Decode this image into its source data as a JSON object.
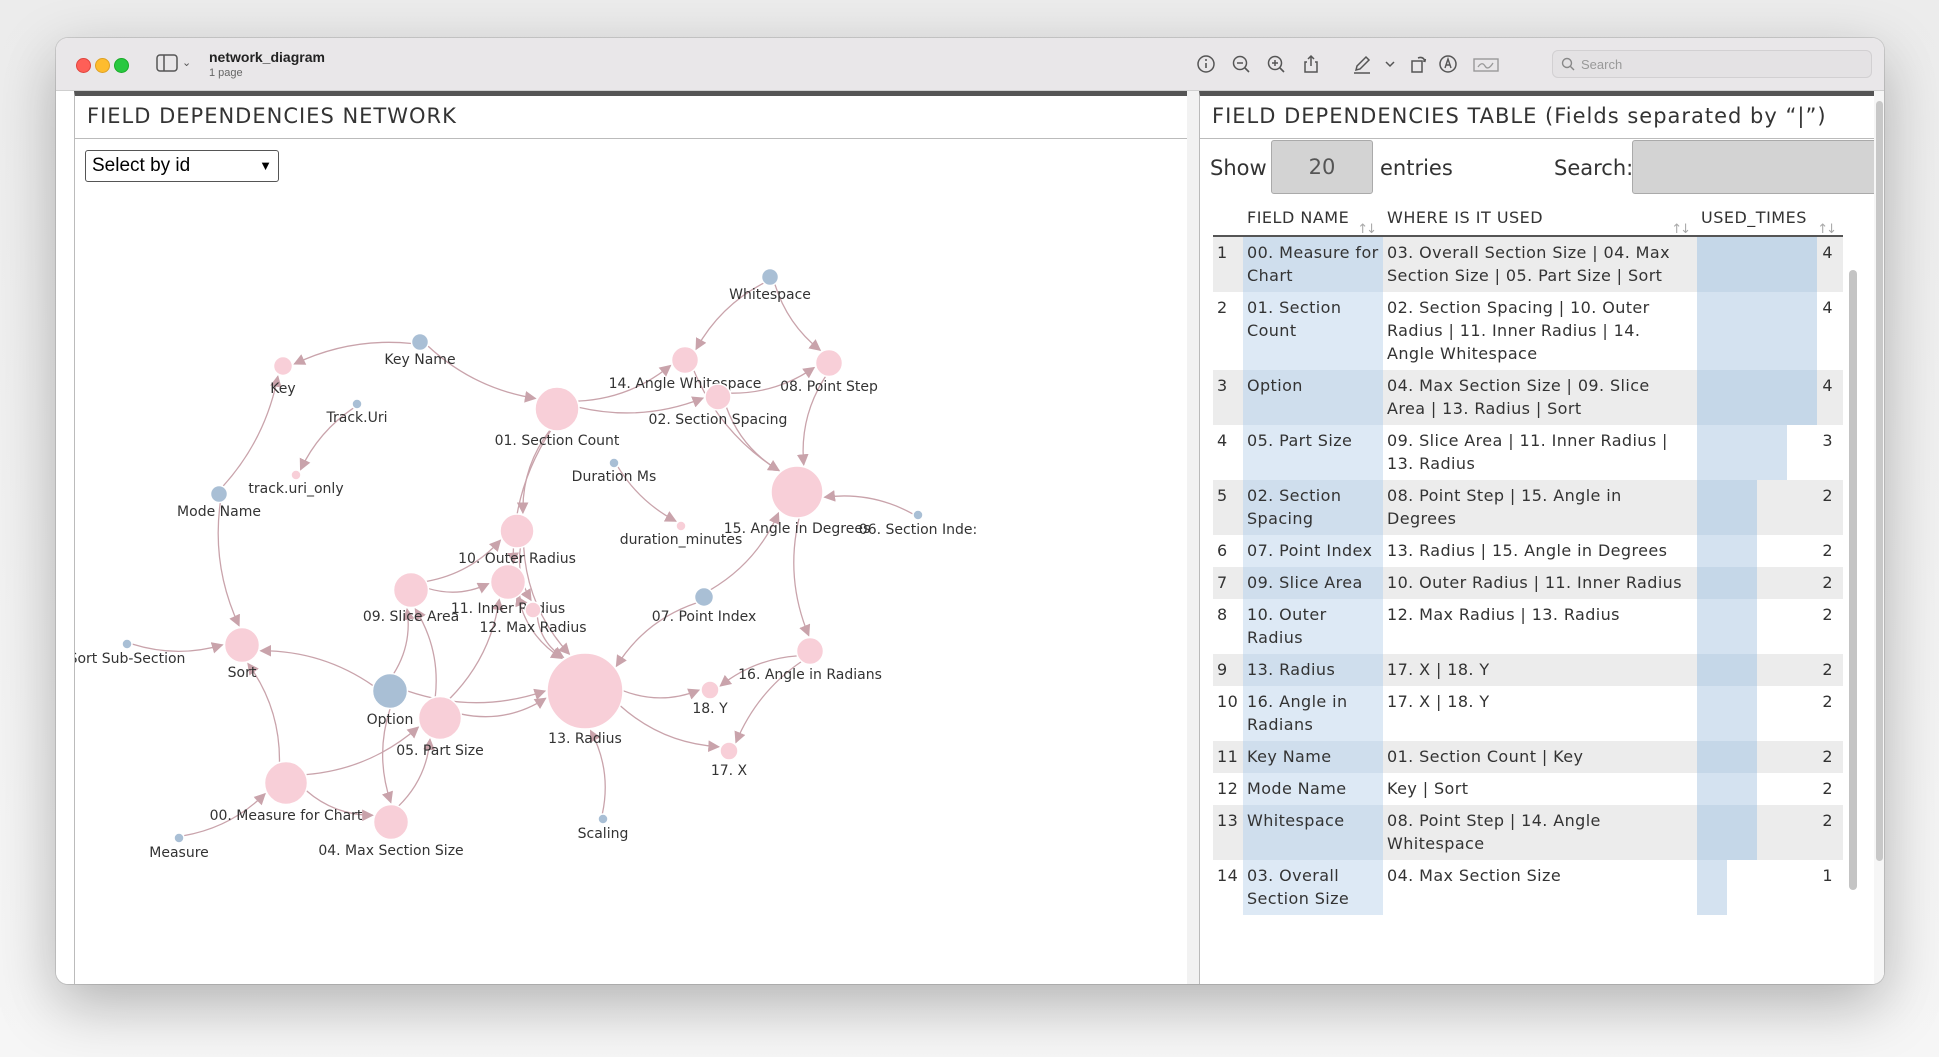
{
  "window": {
    "title": "network_diagram",
    "subtitle": "1 page",
    "search_placeholder": "Search",
    "toolbar_icons": [
      "info-icon",
      "zoom-out-icon",
      "zoom-in-icon",
      "share-icon",
      "markup-pen-icon",
      "chevron-down-icon",
      "rotate-icon",
      "annotate-icon",
      "signature-icon"
    ]
  },
  "network": {
    "title": "FIELD DEPENDENCIES NETWORK",
    "select_label": "Select by id",
    "colors": {
      "calculated": "#f8cfd8",
      "source": "#a9bfd5",
      "edge": "#c9a3ab",
      "label": "#333333"
    },
    "nodes": [
      {
        "id": "whitespace",
        "label": "Whitespace",
        "type": "source"
      },
      {
        "id": "key_name",
        "label": "Key Name",
        "type": "source"
      },
      {
        "id": "key",
        "label": "Key",
        "type": "calculated"
      },
      {
        "id": "track_uri",
        "label": "Track.Uri",
        "type": "source"
      },
      {
        "id": "track_uri_only",
        "label": "track.uri_only",
        "type": "calculated"
      },
      {
        "id": "mode_name",
        "label": "Mode Name",
        "type": "source"
      },
      {
        "id": "section_count",
        "label": "01. Section Count",
        "type": "calculated"
      },
      {
        "id": "angle_whitespace",
        "label": "14. Angle Whitespace",
        "type": "calculated"
      },
      {
        "id": "section_spacing",
        "label": "02. Section Spacing",
        "type": "calculated"
      },
      {
        "id": "point_step",
        "label": "08. Point Step",
        "type": "calculated"
      },
      {
        "id": "duration_ms",
        "label": "Duration Ms",
        "type": "source"
      },
      {
        "id": "duration_minutes",
        "label": "duration_minutes",
        "type": "calculated"
      },
      {
        "id": "angle_degrees",
        "label": "15. Angle in Degrees",
        "type": "calculated"
      },
      {
        "id": "section_index",
        "label": "06. Section Inde:",
        "type": "source"
      },
      {
        "id": "outer_radius",
        "label": "10. Outer Radius",
        "type": "calculated"
      },
      {
        "id": "slice_area",
        "label": "09. Slice Area",
        "type": "calculated"
      },
      {
        "id": "inner_radius",
        "label": "11. Inner Radius",
        "type": "calculated"
      },
      {
        "id": "max_radius",
        "label": "12. Max Radius",
        "type": "calculated"
      },
      {
        "id": "point_index",
        "label": "07. Point Index",
        "type": "source"
      },
      {
        "id": "sort_sub_section",
        "label": "Sort Sub-Section",
        "type": "source"
      },
      {
        "id": "sort",
        "label": "Sort",
        "type": "calculated"
      },
      {
        "id": "option",
        "label": "Option",
        "type": "source"
      },
      {
        "id": "part_size",
        "label": "05. Part Size",
        "type": "calculated"
      },
      {
        "id": "radius",
        "label": "13. Radius",
        "type": "calculated"
      },
      {
        "id": "y",
        "label": "18. Y",
        "type": "calculated"
      },
      {
        "id": "angle_radians",
        "label": "16. Angle in Radians",
        "type": "calculated"
      },
      {
        "id": "x",
        "label": "17. X",
        "type": "calculated"
      },
      {
        "id": "measure_for_chart",
        "label": "00. Measure for Chart",
        "type": "calculated"
      },
      {
        "id": "max_section_size",
        "label": "04. Max Section Size",
        "type": "calculated"
      },
      {
        "id": "measure",
        "label": "Measure",
        "type": "source"
      },
      {
        "id": "scaling",
        "label": "Scaling",
        "type": "source"
      }
    ],
    "edges": [
      [
        "whitespace",
        "angle_whitespace"
      ],
      [
        "whitespace",
        "point_step"
      ],
      [
        "key_name",
        "key"
      ],
      [
        "key_name",
        "section_count"
      ],
      [
        "track_uri",
        "track_uri_only"
      ],
      [
        "mode_name",
        "key"
      ],
      [
        "mode_name",
        "sort"
      ],
      [
        "section_count",
        "angle_whitespace"
      ],
      [
        "section_count",
        "section_spacing"
      ],
      [
        "section_count",
        "outer_radius"
      ],
      [
        "section_count",
        "inner_radius"
      ],
      [
        "section_spacing",
        "point_step"
      ],
      [
        "section_spacing",
        "angle_degrees"
      ],
      [
        "point_step",
        "angle_degrees"
      ],
      [
        "angle_whitespace",
        "angle_degrees"
      ],
      [
        "duration_ms",
        "duration_minutes"
      ],
      [
        "section_index",
        "angle_degrees"
      ],
      [
        "angle_degrees",
        "angle_radians"
      ],
      [
        "point_index",
        "angle_degrees"
      ],
      [
        "point_index",
        "radius"
      ],
      [
        "slice_area",
        "outer_radius"
      ],
      [
        "slice_area",
        "inner_radius"
      ],
      [
        "outer_radius",
        "max_radius"
      ],
      [
        "outer_radius",
        "radius"
      ],
      [
        "inner_radius",
        "max_radius"
      ],
      [
        "inner_radius",
        "radius"
      ],
      [
        "max_radius",
        "radius"
      ],
      [
        "sort_sub_section",
        "sort"
      ],
      [
        "option",
        "sort"
      ],
      [
        "option",
        "slice_area"
      ],
      [
        "option",
        "radius"
      ],
      [
        "option",
        "max_section_size"
      ],
      [
        "part_size",
        "slice_area"
      ],
      [
        "part_size",
        "inner_radius"
      ],
      [
        "part_size",
        "radius"
      ],
      [
        "radius",
        "y"
      ],
      [
        "radius",
        "x"
      ],
      [
        "angle_radians",
        "y"
      ],
      [
        "angle_radians",
        "x"
      ],
      [
        "measure_for_chart",
        "part_size"
      ],
      [
        "measure_for_chart",
        "max_section_size"
      ],
      [
        "measure_for_chart",
        "sort"
      ],
      [
        "max_section_size",
        "part_size"
      ],
      [
        "measure",
        "measure_for_chart"
      ],
      [
        "scaling",
        "radius"
      ]
    ]
  },
  "table": {
    "title": "FIELD DEPENDENCIES TABLE (Fields separated by “|”)",
    "show_label": "Show",
    "entries_value": "20",
    "entries_label": "entries",
    "search_label": "Search:",
    "search_value": "",
    "columns": [
      "FIELD NAME",
      "WHERE IS IT USED",
      "USED_TIMES"
    ],
    "sort_icon": "↑↓",
    "max_used": 4,
    "rows": [
      {
        "n": "1",
        "field": "00. Measure for Chart",
        "used_in": "03. Overall Section Size | 04. Max Section Size | 05. Part Size | Sort",
        "times": 4
      },
      {
        "n": "2",
        "field": "01. Section Count",
        "used_in": "02. Section Spacing | 10. Outer Radius | 11. Inner Radius | 14. Angle Whitespace",
        "times": 4
      },
      {
        "n": "3",
        "field": "Option",
        "used_in": "04. Max Section Size | 09. Slice Area | 13. Radius | Sort",
        "times": 4
      },
      {
        "n": "4",
        "field": "05. Part Size",
        "used_in": "09. Slice Area | 11. Inner Radius | 13. Radius",
        "times": 3
      },
      {
        "n": "5",
        "field": "02. Section Spacing",
        "used_in": "08. Point Step | 15. Angle in Degrees",
        "times": 2
      },
      {
        "n": "6",
        "field": "07. Point Index",
        "used_in": "13. Radius | 15. Angle in Degrees",
        "times": 2
      },
      {
        "n": "7",
        "field": "09. Slice Area",
        "used_in": "10. Outer Radius | 11. Inner Radius",
        "times": 2
      },
      {
        "n": "8",
        "field": "10. Outer Radius",
        "used_in": "12. Max Radius | 13. Radius",
        "times": 2
      },
      {
        "n": "9",
        "field": "13. Radius",
        "used_in": "17. X | 18. Y",
        "times": 2
      },
      {
        "n": "10",
        "field": "16. Angle in Radians",
        "used_in": "17. X | 18. Y",
        "times": 2
      },
      {
        "n": "11",
        "field": "Key Name",
        "used_in": "01. Section Count | Key",
        "times": 2
      },
      {
        "n": "12",
        "field": "Mode Name",
        "used_in": "Key | Sort",
        "times": 2
      },
      {
        "n": "13",
        "field": "Whitespace",
        "used_in": "08. Point Step | 14. Angle Whitespace",
        "times": 2
      },
      {
        "n": "14",
        "field": "03. Overall Section Size",
        "used_in": "04. Max Section Size",
        "times": 1
      }
    ]
  }
}
